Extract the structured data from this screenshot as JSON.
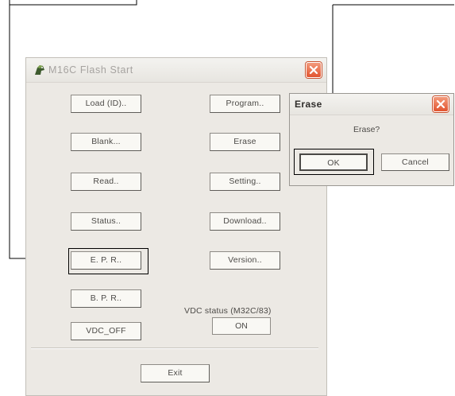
{
  "main_window": {
    "title": "M16C Flash Start",
    "close_icon": "close-icon",
    "buttons": {
      "load": "Load (ID)..",
      "program": "Program..",
      "blank": "Blank...",
      "erase": "Erase",
      "read": "Read..",
      "setting": "Setting..",
      "status": "Status..",
      "download": "Download..",
      "epr": "E. P. R..",
      "version": "Version..",
      "bpr": "B. P. R..",
      "vdc_off": "VDC_OFF",
      "exit": "Exit"
    },
    "vdc_status": {
      "label": "VDC status (M32C/83)",
      "value": "ON"
    }
  },
  "erase_dialog": {
    "title": "Erase",
    "message": "Erase?",
    "ok_label": "OK",
    "cancel_label": "Cancel"
  },
  "colors": {
    "window_bg": "#ece9e4",
    "close_button": "#e2542f",
    "callout_line": "#000000"
  }
}
